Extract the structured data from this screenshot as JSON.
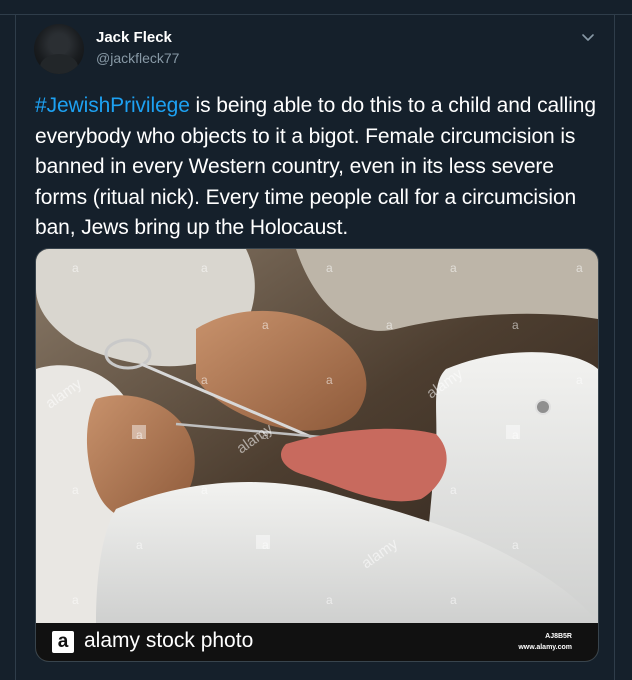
{
  "author": {
    "name": "Jack Fleck",
    "handle": "@jackfleck77",
    "avatar_icon": "user-avatar"
  },
  "tweet": {
    "hashtag": "#JewishPrivilege",
    "body": " is being able to do this to a child and calling everybody who objects to it a bigot. Female circumcision is banned in every Western country, even in its less severe forms (ritual nick). Every time people call for a circumcision ban, Jews bring up the Holocaust."
  },
  "menu_icon": "chevron-down-icon",
  "media": {
    "watermark_mark": "a",
    "watermark_text": "alamy",
    "caption_logo": "a",
    "caption": "alamy stock photo",
    "stock_id": "AJ8B5R",
    "stock_site": "www.alamy.com"
  },
  "colors": {
    "background": "#15202b",
    "text": "#ffffff",
    "secondary": "#8899a6",
    "link": "#1da1f2"
  }
}
